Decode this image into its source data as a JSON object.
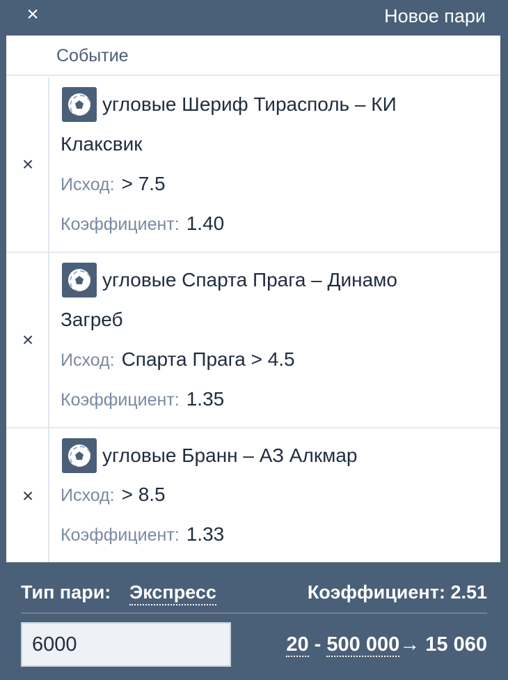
{
  "header": {
    "close_icon": "×",
    "title": "Новое пари"
  },
  "table": {
    "column_event": "Событие"
  },
  "bets": [
    {
      "remove": "×",
      "icon": "soccer-ball-icon",
      "event_line1": "угловые Шериф Тирасполь – КИ",
      "event_line2": "Клаксвик",
      "outcome_label": "Исход:",
      "outcome_value": "> 7.5",
      "odds_label": "Коэффициент:",
      "odds_value": "1.40"
    },
    {
      "remove": "×",
      "icon": "soccer-ball-icon",
      "event_line1": "угловые Спарта Прага – Динамо",
      "event_line2": "Загреб",
      "outcome_label": "Исход:",
      "outcome_value": "Спарта Прага > 4.5",
      "odds_label": "Коэффициент:",
      "odds_value": "1.35"
    },
    {
      "remove": "×",
      "icon": "soccer-ball-icon",
      "event_line1": "угловые Бранн – АЗ Алкмар",
      "event_line2": "",
      "outcome_label": "Исход:",
      "outcome_value": "> 8.5",
      "odds_label": "Коэффициент:",
      "odds_value": "1.33"
    }
  ],
  "footer": {
    "bet_type_label": "Тип пари:",
    "bet_type_value": "Экспресс",
    "total_odds": "Коэффициент: 2.51",
    "stake_value": "6000",
    "min_stake": "20",
    "separator": "-",
    "max_stake": "500 000",
    "arrow": "→",
    "payout": "15 060"
  },
  "colors": {
    "frame": "#4a5f78",
    "text": "#1f2d3d",
    "muted": "#7a8aa1"
  }
}
